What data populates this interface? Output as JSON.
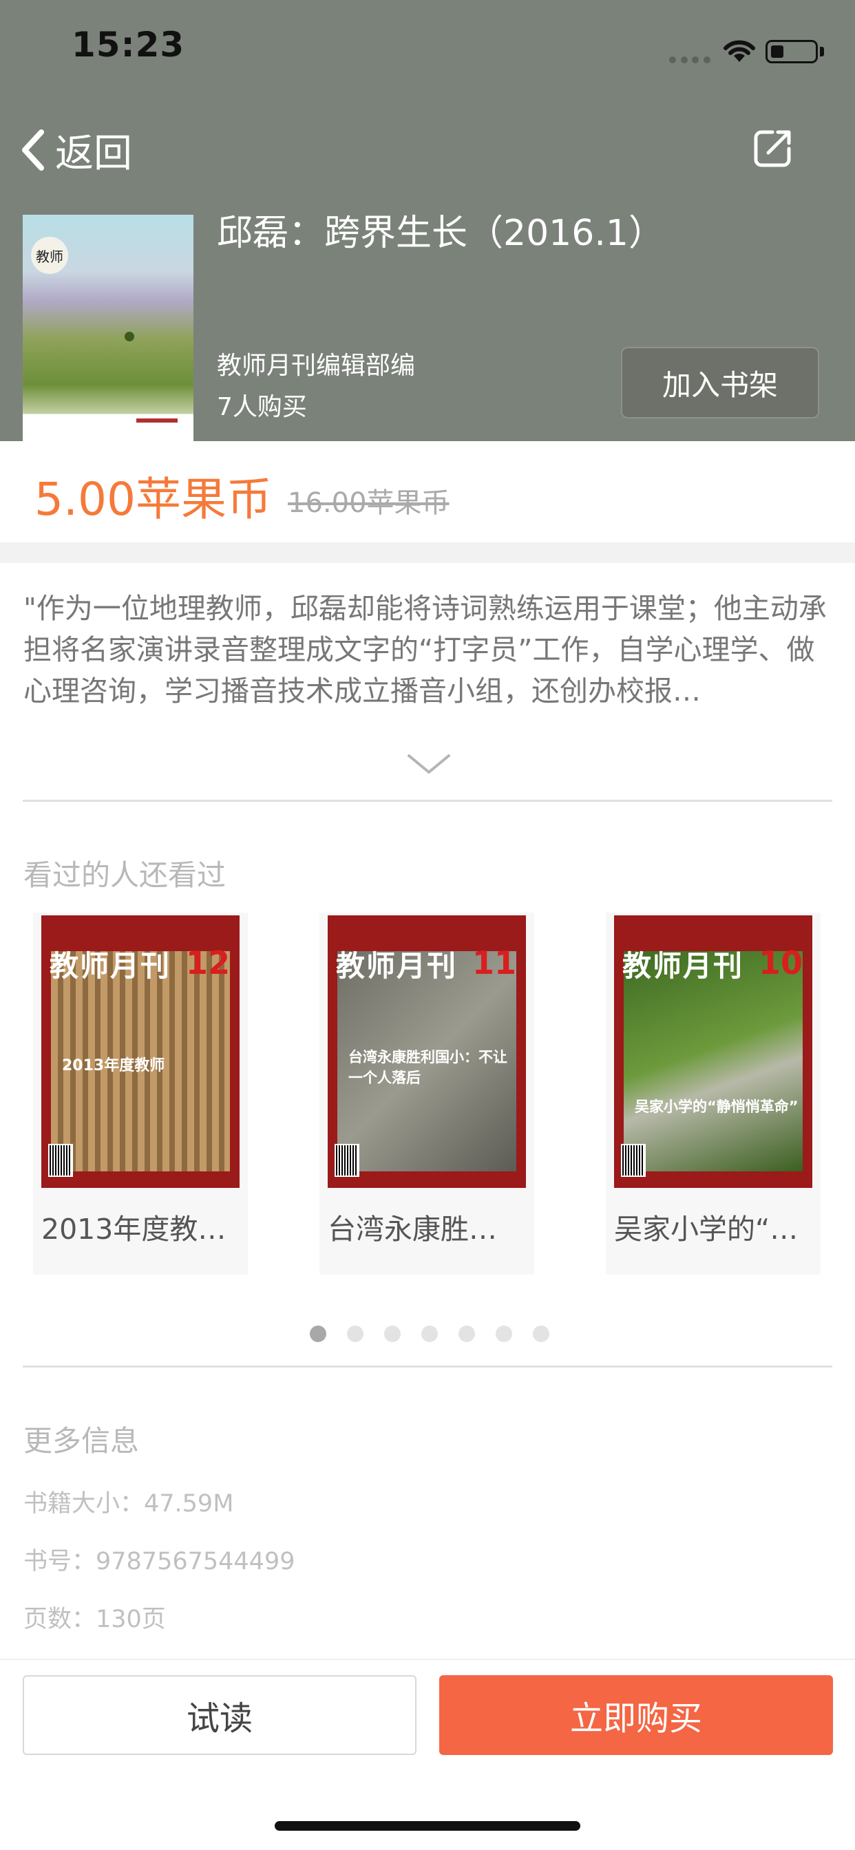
{
  "status_bar": {
    "time": "15:23"
  },
  "nav": {
    "back_label": "返回",
    "share_icon": "share-icon"
  },
  "book": {
    "title": "邱磊：跨界生长（2016.1）",
    "author": "教师月刊编辑部编",
    "buyers": "7人购买",
    "add_shelf_label": "加入书架",
    "cover_logo_text": "教师"
  },
  "price": {
    "current": "5.00苹果币",
    "original": "16.00苹果币",
    "accent_color": "#f57a3a"
  },
  "description": {
    "text": "\"作为一位地理教师，邱磊却能将诗词熟练运用于课堂；他主动承担将名家演讲录音整理成文字的“打字员”工作，自学心理学、做心理咨询，学习播音技术成立播音小组，还创办校报…"
  },
  "recommendations": {
    "title": "看过的人还看过",
    "items": [
      {
        "label": "2013年度教…",
        "mag": "教师月刊",
        "issue": "12",
        "cover_text": "2013年度教师",
        "cover_color": "#b38d5c"
      },
      {
        "label": "台湾永康胜…",
        "mag": "教师月刊",
        "issue": "11",
        "cover_text": "台湾永康胜利国小：不让一个人落后",
        "cover_color": "#8a8a7a"
      },
      {
        "label": "吴家小学的“…",
        "mag": "教师月刊",
        "issue": "10",
        "cover_text": "吴家小学的“静悄悄革命”",
        "cover_color": "#4f7a2d"
      }
    ],
    "page_count": 7,
    "active_page": 0
  },
  "more_info": {
    "title": "更多信息",
    "size": "书籍大小：47.59M",
    "isbn": "书号：9787567544499",
    "pages": "页数：130页"
  },
  "actions": {
    "try_label": "试读",
    "buy_label": "立即购买",
    "buy_color": "#f46644"
  }
}
